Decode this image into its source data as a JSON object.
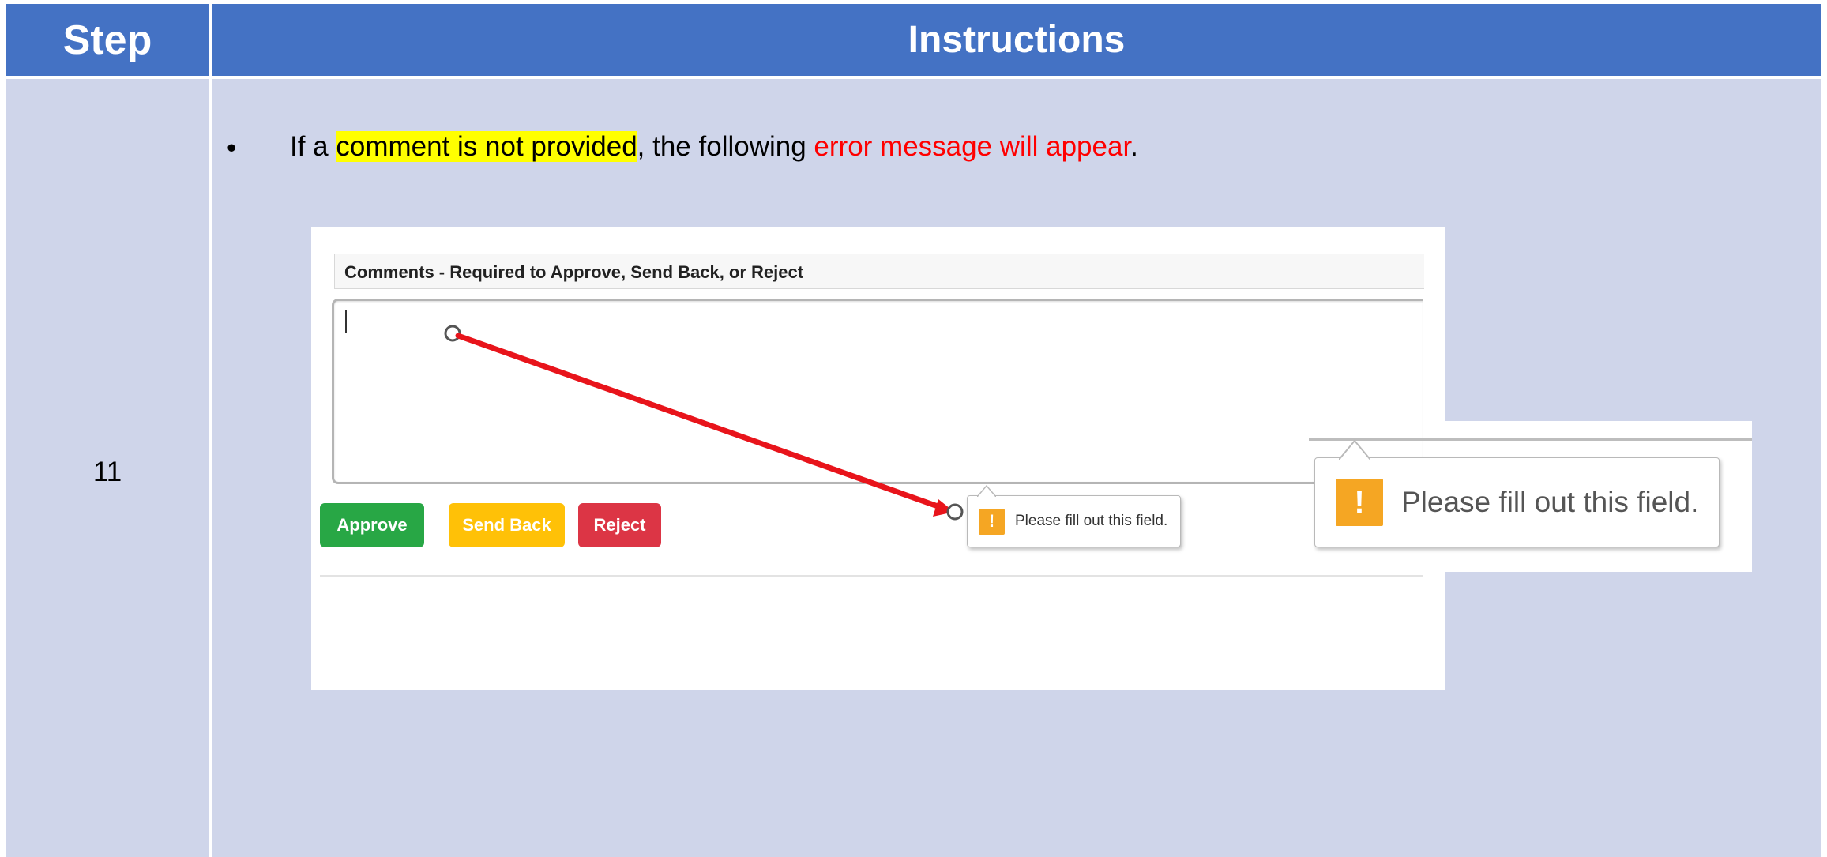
{
  "table": {
    "col1_header": "Step",
    "col2_header": "Instructions",
    "step_number": "11",
    "instruction": {
      "bullet": "•",
      "part1": "If a ",
      "highlight": "comment is not provided",
      "part2": ", the following ",
      "red": "error message will appear",
      "part3": "."
    }
  },
  "screenshot": {
    "comments_label": "Comments - Required to Approve, Send Back, or Reject",
    "buttons": {
      "approve": "Approve",
      "send_back": "Send Back",
      "reject": "Reject"
    },
    "tooltip_text": "Please fill out this field.",
    "tooltip_icon": "!",
    "zoom_tooltip_text": "Please fill out this field.",
    "zoom_tooltip_icon": "!"
  },
  "colors": {
    "header_blue": "#4472c4",
    "cell_lavender": "#cfd5ea",
    "highlight_yellow": "#ffff00",
    "error_red": "#ff0000",
    "annotation_arrow": "#e8141b",
    "approve_green": "#28a745",
    "send_back_yellow": "#ffc107",
    "reject_red": "#dc3545",
    "warning_orange": "#f5a623"
  },
  "icons": {
    "tooltip_warning": "exclamation-warning-icon",
    "arrow": "red-arrow-annotation"
  }
}
